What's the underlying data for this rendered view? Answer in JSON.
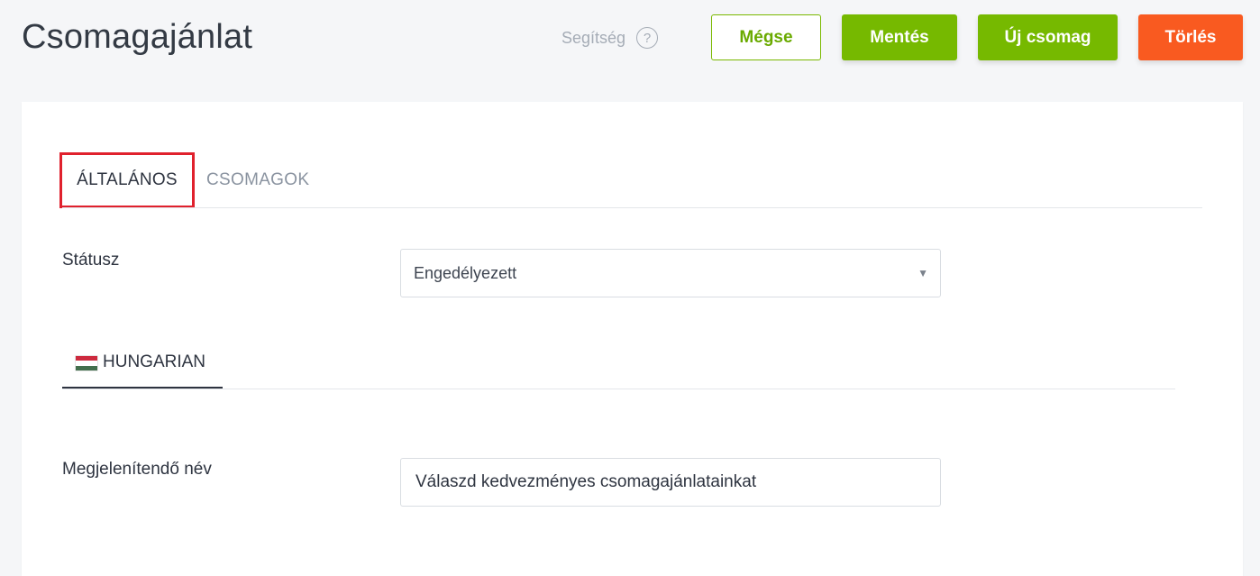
{
  "header": {
    "title": "Csomagajánlat",
    "help_label": "Segítség",
    "help_icon": "?"
  },
  "toolbar": {
    "cancel_label": "Mégse",
    "save_label": "Mentés",
    "new_label": "Új csomag",
    "delete_label": "Törlés"
  },
  "tabs": [
    {
      "label": "ÁLTALÁNOS",
      "active": true
    },
    {
      "label": "CSOMAGOK",
      "active": false
    }
  ],
  "status": {
    "label": "Státusz",
    "selected": "Engedélyezett",
    "arrow": "▼"
  },
  "language_tab": {
    "label": "HUNGARIAN",
    "flag_colors": [
      "#cd2a3e",
      "#ffffff",
      "#436f4d"
    ]
  },
  "display_name": {
    "label": "Megjelenítendő név",
    "value": "Válaszd kedvezményes csomagajánlatainkat"
  },
  "colors": {
    "accent_green": "#76b900",
    "danger_orange": "#f95a20",
    "highlight_red": "#e0212d"
  }
}
